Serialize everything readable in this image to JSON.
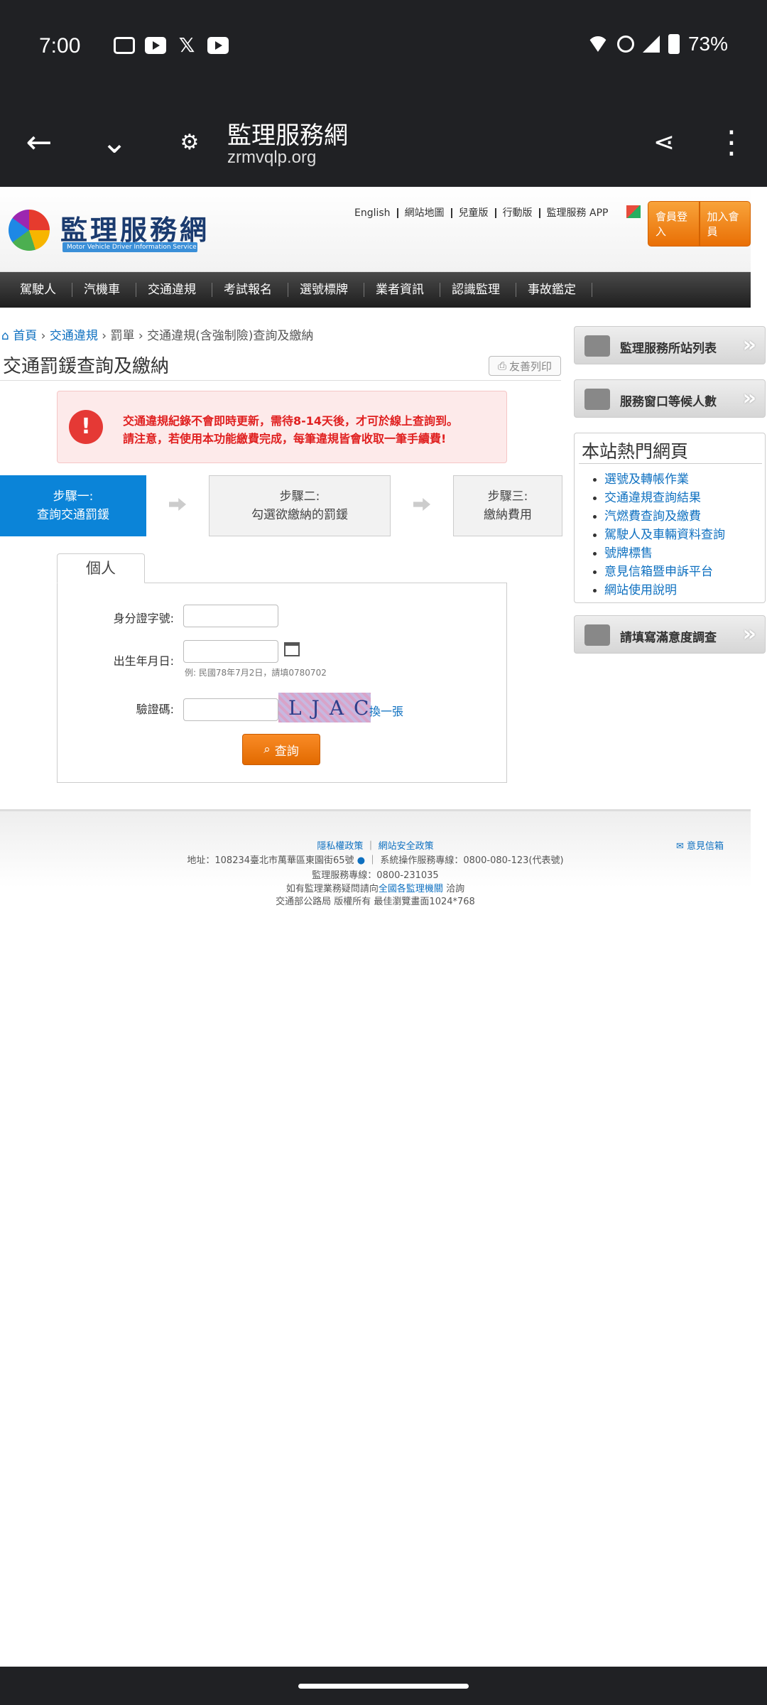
{
  "status": {
    "time": "7:00",
    "battery": "73%"
  },
  "browser": {
    "title": "監理服務網",
    "url": "zrmvqlp.org"
  },
  "header": {
    "logo_text": "監理服務網",
    "logo_sub": "Motor Vehicle Driver Information Service",
    "top_links": [
      "English",
      "網站地圖",
      "兒童版",
      "行動版",
      "監理服務 APP"
    ],
    "login_label": "會員登入",
    "join_label": "加入會員"
  },
  "nav": [
    "駕駛人",
    "汽機車",
    "交通違規",
    "考試報名",
    "選號標牌",
    "業者資訊",
    "認識監理",
    "事故鑑定"
  ],
  "breadcrumb": {
    "home": "首頁",
    "sep1": "›",
    "level1": "交通違規",
    "sep2": "›",
    "level2": "罰單",
    "sep3": "›",
    "current": "交通違規(含強制險)查詢及繳納"
  },
  "page": {
    "title": "交通罰鍰查詢及繳納",
    "print_label": "友善列印"
  },
  "alert": {
    "line1": "交通違規紀錄不會即時更新，需待8-14天後，才可於線上查詢到。",
    "line2": "請注意，若使用本功能繳費完成，每筆違規皆會收取一筆手續費!"
  },
  "steps": [
    {
      "line1": "步驟一:",
      "line2": "查詢交通罰鍰"
    },
    {
      "line1": "步驟二:",
      "line2": "勾選欲繳納的罰鍰"
    },
    {
      "line1": "步驟三:",
      "line2": "繳納費用"
    }
  ],
  "form": {
    "tab_label": "個人",
    "id_label": "身分證字號:",
    "id_value": "",
    "birth_label": "出生年月日:",
    "birth_value": "",
    "birth_hint": "例: 民國78年7月2日，請填0780702",
    "captcha_label": "驗證碼:",
    "captcha_value": "",
    "captcha_text": "LJAC",
    "refresh_label": "換一張",
    "submit_label": "查詢"
  },
  "sidebar": {
    "btn1": "監理服務所站列表",
    "btn2": "服務窗口等候人數",
    "hot_title": "本站熱門網頁",
    "hot_links": [
      "選號及轉帳作業",
      "交通違規查詢結果",
      "汽燃費查詢及繳費",
      "駕駛人及車輛資料查詢",
      "號牌標售",
      "意見信箱暨申訴平台",
      "網站使用說明"
    ],
    "btn3": "請填寫滿意度調查"
  },
  "footer": {
    "privacy": "隱私權政策",
    "security": "網站安全政策",
    "address": "地址：108234臺北市萬華區東園街65號",
    "hotline": "系統操作服務專線：0800-080-123(代表號)",
    "service_line": "監理服務專線：0800-231035",
    "contact_pre": "如有監理業務疑問請向",
    "contact_link": "全國各監理機關",
    "contact_post": " 洽詢",
    "copyright": "交通部公路局 版權所有 最佳瀏覽畫面1024*768",
    "feedback": "意見信箱"
  }
}
